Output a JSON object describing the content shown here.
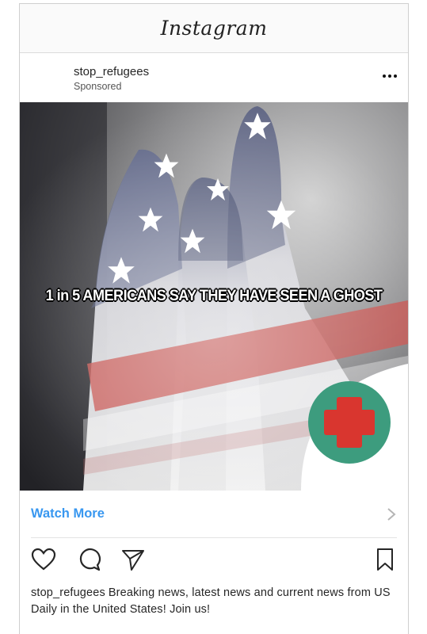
{
  "app": {
    "title": "Instagram"
  },
  "post": {
    "username": "stop_refugees",
    "sponsored_label": "Sponsored",
    "more_icon": "more-horizontal-icon",
    "image_overlay_text": "1 in 5 AMERICANS SAY THEY HAVE SEEN A GHOST",
    "badge_icon": "medical-cross-icon",
    "cta_label": "Watch More",
    "cta_icon": "chevron-right-icon",
    "caption_user": "stop_refugees",
    "caption_text": "Breaking news, latest news and current news from US Daily in the United States! Join us!"
  },
  "actions": {
    "like_icon": "heart-icon",
    "comment_icon": "comment-icon",
    "share_icon": "send-icon",
    "save_icon": "bookmark-icon"
  },
  "colors": {
    "link_blue": "#3897f0",
    "badge_green": "#3d9c7e",
    "badge_red": "#d9362f"
  }
}
